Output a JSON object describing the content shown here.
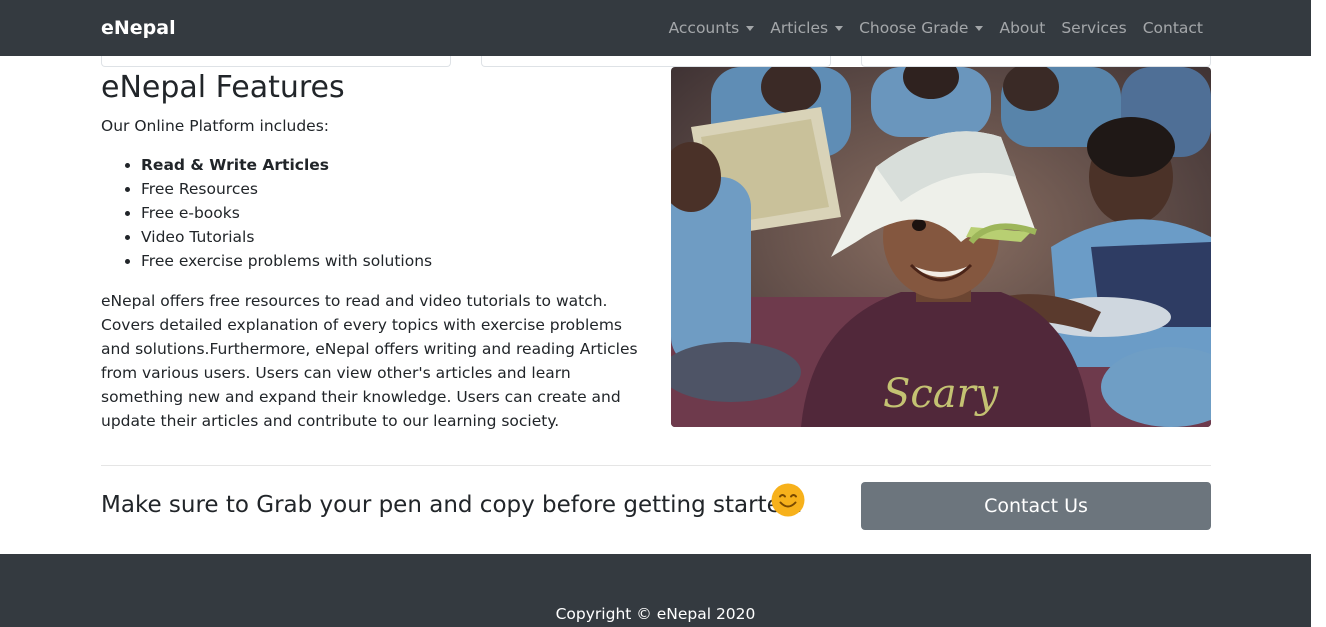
{
  "navbar": {
    "brand": "eNepal",
    "links": [
      {
        "label": "Accounts",
        "dropdown": true
      },
      {
        "label": "Articles",
        "dropdown": true
      },
      {
        "label": "Choose Grade",
        "dropdown": true
      },
      {
        "label": "About",
        "dropdown": false
      },
      {
        "label": "Services",
        "dropdown": false
      },
      {
        "label": "Contact",
        "dropdown": false
      }
    ]
  },
  "features": {
    "title": "eNepal Features",
    "intro": "Our Online Platform includes:",
    "items": [
      "Read & Write Articles",
      "Free Resources",
      "Free e-books",
      "Video Tutorials",
      "Free exercise problems with solutions"
    ],
    "description": "eNepal offers free resources to read and video tutorials to watch. Covers detailed explanation of every topics with exercise problems and solutions.Furthermore, eNepal offers writing and reading Articles from various users. Users can view other's articles and learn something new and expand their knowledge. Users can create and update their articles and contribute to our learning society.",
    "photo_text": "Scary"
  },
  "cta": {
    "text": "Make sure to Grab your pen and copy before getting started.",
    "icon": "smiley-icon",
    "button_label": "Contact Us"
  },
  "footer": {
    "copyright": "Copyright © eNepal 2020"
  },
  "colors": {
    "navbar_bg": "#343a40",
    "button_bg": "#6c757d",
    "smiley": "#f7b11b"
  }
}
